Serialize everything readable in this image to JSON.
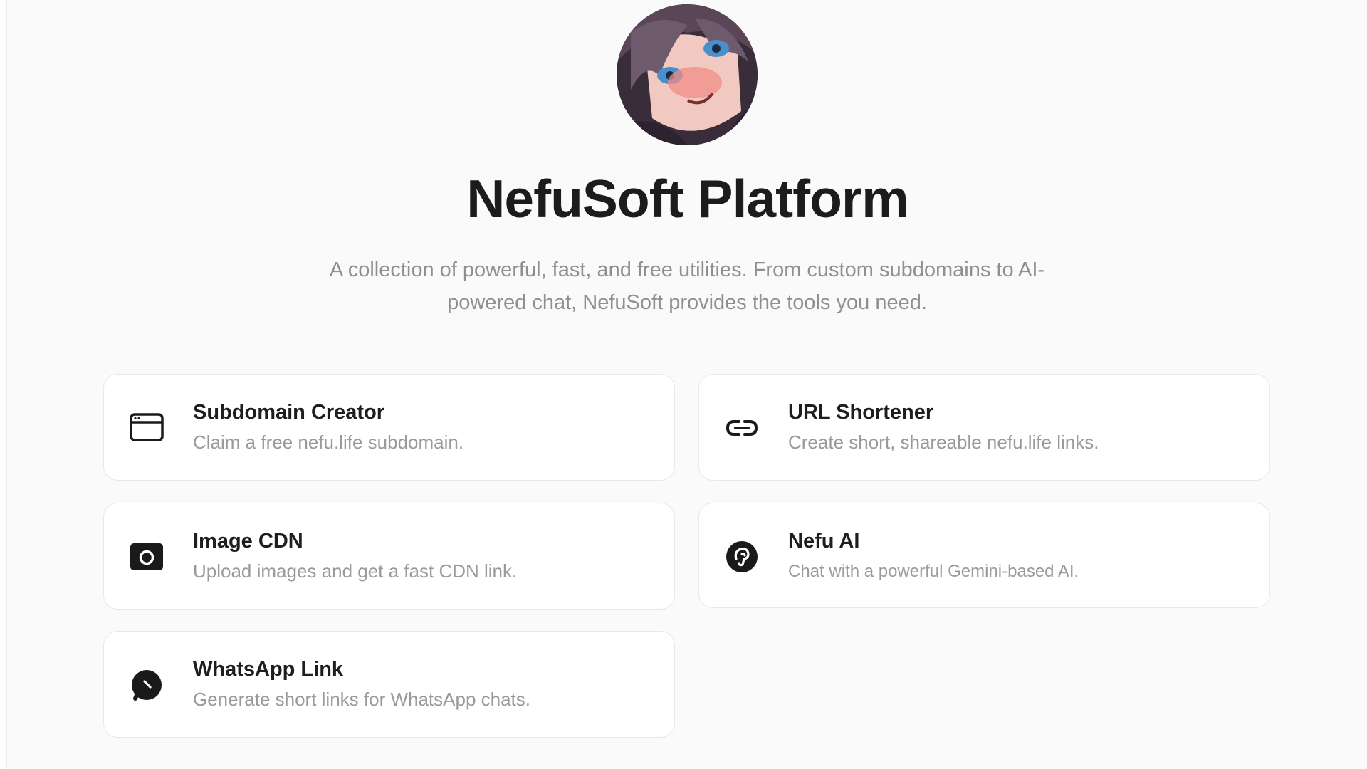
{
  "header": {
    "title": "NefuSoft Platform",
    "subtitle": "A collection of powerful, fast, and free utilities. From custom subdomains to AI-powered chat, NefuSoft provides the tools you need."
  },
  "avatar": {
    "alt": "avatar"
  },
  "tools": [
    {
      "title": "Subdomain Creator",
      "description": "Claim a free nefu.life subdomain.",
      "icon": "browser-window-icon"
    },
    {
      "title": "URL Shortener",
      "description": "Create short, shareable nefu.life links.",
      "icon": "link-icon"
    },
    {
      "title": "Image CDN",
      "description": "Upload images and get a fast CDN link.",
      "icon": "camera-icon"
    },
    {
      "title": "Nefu AI",
      "description": "Chat with a powerful Gemini-based AI.",
      "icon": "ai-brain-icon"
    },
    {
      "title": "WhatsApp Link",
      "description": "Generate short links for WhatsApp chats.",
      "icon": "whatsapp-icon"
    }
  ],
  "colors": {
    "background": "#fafafa",
    "card": "#ffffff",
    "border": "#e8e8e8",
    "title": "#1c1c1c",
    "muted": "#9a9a9a"
  }
}
